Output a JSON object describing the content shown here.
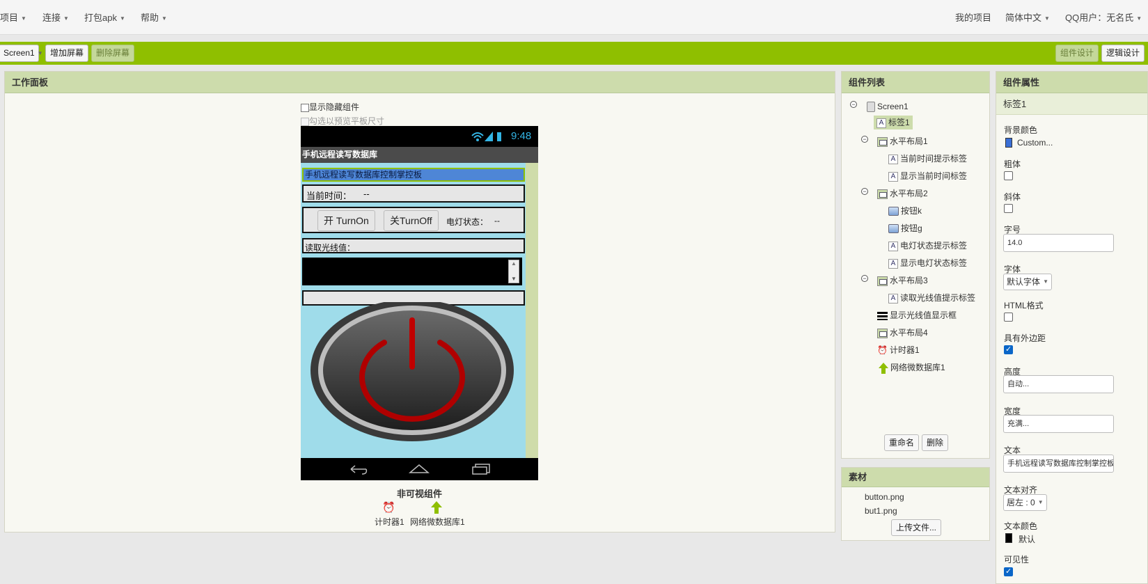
{
  "topbar": {
    "menus": [
      "项目",
      "连接",
      "打包apk",
      "帮助"
    ],
    "right": {
      "my_projects": "我的项目",
      "language": "简体中文",
      "user": "QQ用户：无名氏"
    }
  },
  "toolbar": {
    "screen_select": "Screen1",
    "add_screen": "增加屏幕",
    "remove_screen": "删除屏幕",
    "designer": "组件设计",
    "blocks": "逻辑设计"
  },
  "viewer": {
    "title": "工作面板",
    "show_hidden": "显示隐藏组件",
    "tablet_preview": "勾选以预览平板尺寸",
    "phone": {
      "time": "9:48",
      "app_title": "手机远程读写数据库",
      "header_label": "手机远程读写数据库控制掌控板",
      "time_label": "当前时间：",
      "time_value": "--",
      "btn_on": "开 TurnOn",
      "btn_off": "关TurnOff",
      "lamp_label": "电灯状态：",
      "lamp_value": "--",
      "light_label": "读取光线值："
    },
    "nonvisible_title": "非可视组件",
    "nonvisible": [
      {
        "label": "计时器1",
        "icon": "alarm-clock-icon"
      },
      {
        "label": "网络微数据库1",
        "icon": "up-arrow-icon"
      }
    ]
  },
  "components": {
    "title": "组件列表",
    "tree": [
      {
        "label": "Screen1",
        "icon": "screen-icon",
        "toggle": "⊖"
      },
      {
        "label": "标签1",
        "icon": "label-icon",
        "selected": true
      },
      {
        "label": "水平布局1",
        "icon": "layout-icon",
        "toggle": "⊖"
      },
      {
        "label": "当前时间提示标签",
        "icon": "label-icon"
      },
      {
        "label": "显示当前时间标签",
        "icon": "label-icon"
      },
      {
        "label": "水平布局2",
        "icon": "layout-icon",
        "toggle": "⊖"
      },
      {
        "label": "按钮k",
        "icon": "button-icon"
      },
      {
        "label": "按钮g",
        "icon": "button-icon"
      },
      {
        "label": "电灯状态提示标签",
        "icon": "label-icon"
      },
      {
        "label": "显示电灯状态标签",
        "icon": "label-icon"
      },
      {
        "label": "水平布局3",
        "icon": "layout-icon",
        "toggle": "⊖"
      },
      {
        "label": "读取光线值提示标签",
        "icon": "label-icon"
      },
      {
        "label": "显示光线值显示框",
        "icon": "listview-icon"
      },
      {
        "label": "水平布局4",
        "icon": "layout-icon"
      },
      {
        "label": "计时器1",
        "icon": "alarm-clock-icon"
      },
      {
        "label": "网络微数据库1",
        "icon": "up-arrow-icon"
      }
    ],
    "rename": "重命名",
    "delete": "删除"
  },
  "media": {
    "title": "素材",
    "files": [
      "button.png",
      "but1.png"
    ],
    "upload": "上传文件..."
  },
  "properties": {
    "title": "组件属性",
    "component": "标签1",
    "bg_color_label": "背景颜色",
    "bg_color_value": "Custom...",
    "bg_color": "#3a6fd6",
    "bold_label": "粗体",
    "italic_label": "斜体",
    "fontsize_label": "字号",
    "fontsize_value": "14.0",
    "font_label": "字体",
    "font_value": "默认字体",
    "html_label": "HTML格式",
    "margin_label": "具有外边距",
    "height_label": "高度",
    "height_value": "自动...",
    "width_label": "宽度",
    "width_value": "充满...",
    "text_label": "文本",
    "text_value": "手机远程读写数据库控制掌控板",
    "align_label": "文本对齐",
    "align_value": "居左 : 0",
    "textcolor_label": "文本颜色",
    "textcolor_value": "默认",
    "textcolor": "#000000",
    "visible_label": "可见性"
  }
}
